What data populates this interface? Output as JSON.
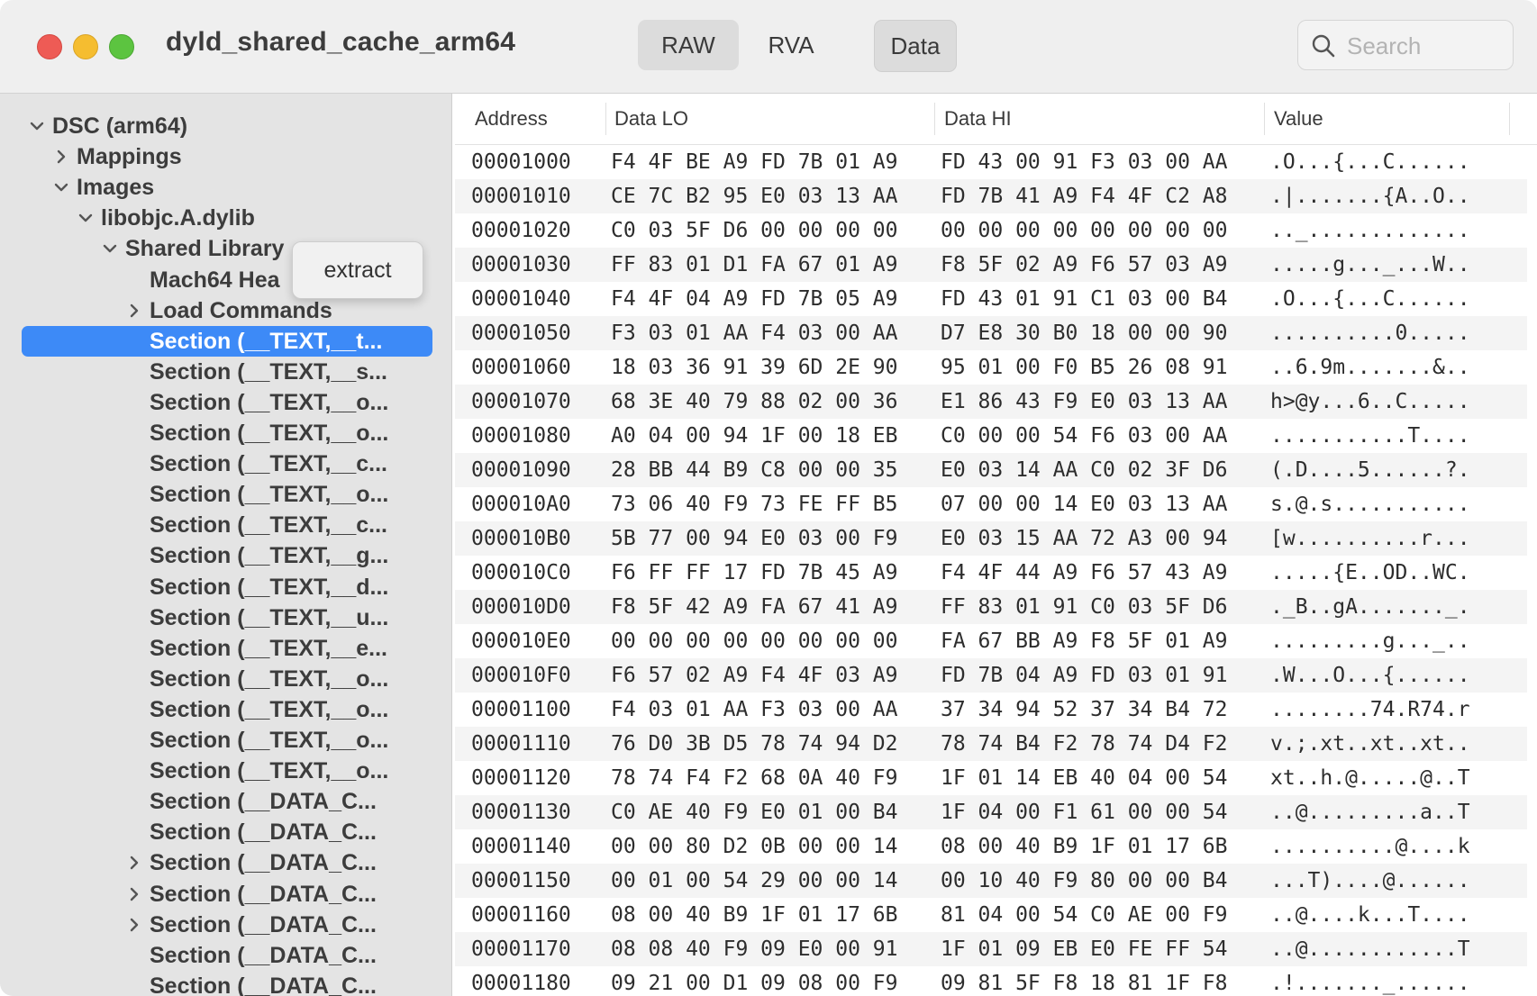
{
  "window": {
    "title": "dyld_shared_cache_arm64"
  },
  "toolbar": {
    "tabs": [
      "RAW",
      "RVA",
      "Data"
    ],
    "active_tab": "Data",
    "search_placeholder": "Search"
  },
  "sidebar": {
    "items": [
      {
        "label": "DSC (arm64)",
        "chevron": "down"
      },
      {
        "label": "Mappings",
        "chevron": "right"
      },
      {
        "label": "Images",
        "chevron": "down"
      },
      {
        "label": "libobjc.A.dylib",
        "chevron": "down"
      },
      {
        "label": "Shared Library",
        "chevron": "down"
      },
      {
        "label": "Mach64 Hea",
        "chevron": "none"
      },
      {
        "label": "Load Commands",
        "chevron": "right"
      },
      {
        "label": "Section (__TEXT,__t...",
        "chevron": "none",
        "selected": true
      },
      {
        "label": "Section (__TEXT,__s...",
        "chevron": "none"
      },
      {
        "label": "Section (__TEXT,__o...",
        "chevron": "none"
      },
      {
        "label": "Section (__TEXT,__o...",
        "chevron": "none"
      },
      {
        "label": "Section (__TEXT,__c...",
        "chevron": "none"
      },
      {
        "label": "Section (__TEXT,__o...",
        "chevron": "none"
      },
      {
        "label": "Section (__TEXT,__c...",
        "chevron": "none"
      },
      {
        "label": "Section (__TEXT,__g...",
        "chevron": "none"
      },
      {
        "label": "Section (__TEXT,__d...",
        "chevron": "none"
      },
      {
        "label": "Section (__TEXT,__u...",
        "chevron": "none"
      },
      {
        "label": "Section (__TEXT,__e...",
        "chevron": "none"
      },
      {
        "label": "Section (__TEXT,__o...",
        "chevron": "none"
      },
      {
        "label": "Section (__TEXT,__o...",
        "chevron": "none"
      },
      {
        "label": "Section (__TEXT,__o...",
        "chevron": "none"
      },
      {
        "label": "Section (__TEXT,__o...",
        "chevron": "none"
      },
      {
        "label": "Section (__DATA_C...",
        "chevron": "none"
      },
      {
        "label": "Section (__DATA_C...",
        "chevron": "none"
      },
      {
        "label": "Section (__DATA_C...",
        "chevron": "right"
      },
      {
        "label": "Section (__DATA_C...",
        "chevron": "right"
      },
      {
        "label": "Section (__DATA_C...",
        "chevron": "right"
      },
      {
        "label": "Section (__DATA_C...",
        "chevron": "none"
      },
      {
        "label": "Section (__DATA_C...",
        "chevron": "none"
      }
    ]
  },
  "context_menu": {
    "item": "extract"
  },
  "table": {
    "columns": [
      "Address",
      "Data LO",
      "Data HI",
      "Value"
    ],
    "rows": [
      {
        "address": "00001000",
        "lo": "F4 4F BE A9 FD 7B 01 A9",
        "hi": "FD 43 00 91 F3 03 00 AA",
        "value": ".O...{...C......"
      },
      {
        "address": "00001010",
        "lo": "CE 7C B2 95 E0 03 13 AA",
        "hi": "FD 7B 41 A9 F4 4F C2 A8",
        "value": ".|.......{A..O.."
      },
      {
        "address": "00001020",
        "lo": "C0 03 5F D6 00 00 00 00",
        "hi": "00 00 00 00 00 00 00 00",
        "value": ".._............."
      },
      {
        "address": "00001030",
        "lo": "FF 83 01 D1 FA 67 01 A9",
        "hi": "F8 5F 02 A9 F6 57 03 A9",
        "value": ".....g..._...W.."
      },
      {
        "address": "00001040",
        "lo": "F4 4F 04 A9 FD 7B 05 A9",
        "hi": "FD 43 01 91 C1 03 00 B4",
        "value": ".O...{...C......"
      },
      {
        "address": "00001050",
        "lo": "F3 03 01 AA F4 03 00 AA",
        "hi": "D7 E8 30 B0 18 00 00 90",
        "value": "..........0....."
      },
      {
        "address": "00001060",
        "lo": "18 03 36 91 39 6D 2E 90",
        "hi": "95 01 00 F0 B5 26 08 91",
        "value": "..6.9m.......&.."
      },
      {
        "address": "00001070",
        "lo": "68 3E 40 79 88 02 00 36",
        "hi": "E1 86 43 F9 E0 03 13 AA",
        "value": "h>@y...6..C....."
      },
      {
        "address": "00001080",
        "lo": "A0 04 00 94 1F 00 18 EB",
        "hi": "C0 00 00 54 F6 03 00 AA",
        "value": "...........T...."
      },
      {
        "address": "00001090",
        "lo": "28 BB 44 B9 C8 00 00 35",
        "hi": "E0 03 14 AA C0 02 3F D6",
        "value": "(.D....5......?."
      },
      {
        "address": "000010A0",
        "lo": "73 06 40 F9 73 FE FF B5",
        "hi": "07 00 00 14 E0 03 13 AA",
        "value": "s.@.s..........."
      },
      {
        "address": "000010B0",
        "lo": "5B 77 00 94 E0 03 00 F9",
        "hi": "E0 03 15 AA 72 A3 00 94",
        "value": "[w..........r..."
      },
      {
        "address": "000010C0",
        "lo": "F6 FF FF 17 FD 7B 45 A9",
        "hi": "F4 4F 44 A9 F6 57 43 A9",
        "value": ".....{E..OD..WC."
      },
      {
        "address": "000010D0",
        "lo": "F8 5F 42 A9 FA 67 41 A9",
        "hi": "FF 83 01 91 C0 03 5F D6",
        "value": "._B..gA......._."
      },
      {
        "address": "000010E0",
        "lo": "00 00 00 00 00 00 00 00",
        "hi": "FA 67 BB A9 F8 5F 01 A9",
        "value": ".........g..._.."
      },
      {
        "address": "000010F0",
        "lo": "F6 57 02 A9 F4 4F 03 A9",
        "hi": "FD 7B 04 A9 FD 03 01 91",
        "value": ".W...O...{......"
      },
      {
        "address": "00001100",
        "lo": "F4 03 01 AA F3 03 00 AA",
        "hi": "37 34 94 52 37 34 B4 72",
        "value": "........74.R74.r"
      },
      {
        "address": "00001110",
        "lo": "76 D0 3B D5 78 74 94 D2",
        "hi": "78 74 B4 F2 78 74 D4 F2",
        "value": "v.;.xt..xt..xt.."
      },
      {
        "address": "00001120",
        "lo": "78 74 F4 F2 68 0A 40 F9",
        "hi": "1F 01 14 EB 40 04 00 54",
        "value": "xt..h.@.....@..T"
      },
      {
        "address": "00001130",
        "lo": "C0 AE 40 F9 E0 01 00 B4",
        "hi": "1F 04 00 F1 61 00 00 54",
        "value": "..@.........a..T"
      },
      {
        "address": "00001140",
        "lo": "00 00 80 D2 0B 00 00 14",
        "hi": "08 00 40 B9 1F 01 17 6B",
        "value": "..........@....k"
      },
      {
        "address": "00001150",
        "lo": "00 01 00 54 29 00 00 14",
        "hi": "00 10 40 F9 80 00 00 B4",
        "value": "...T)....@......"
      },
      {
        "address": "00001160",
        "lo": "08 00 40 B9 1F 01 17 6B",
        "hi": "81 04 00 54 C0 AE 00 F9",
        "value": "..@....k...T...."
      },
      {
        "address": "00001170",
        "lo": "08 08 40 F9 09 E0 00 91",
        "hi": "1F 01 09 EB E0 FE FF 54",
        "value": "..@............T"
      },
      {
        "address": "00001180",
        "lo": "09 21 00 D1 09 08 00 F9",
        "hi": "09 81 5F F8 18 81 1F F8",
        "value": ".!......._......"
      }
    ]
  }
}
